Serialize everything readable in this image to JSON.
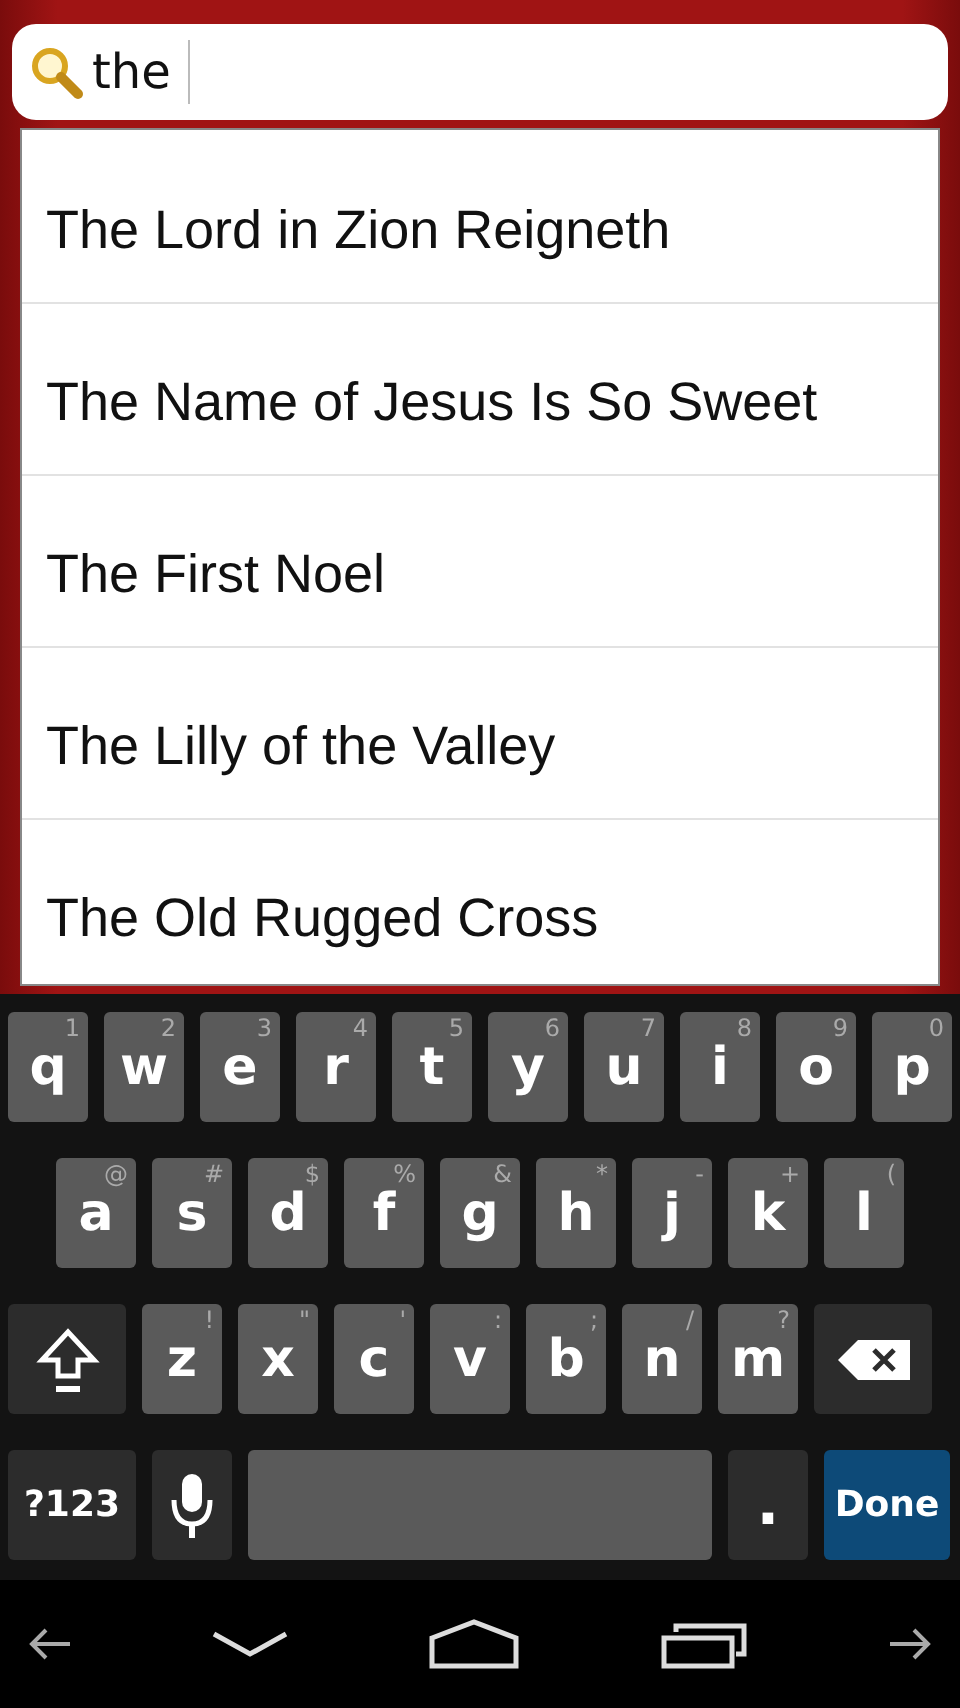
{
  "search": {
    "value": "the"
  },
  "suggestions": [
    "The Lord in Zion Reigneth",
    "The Name of Jesus Is So Sweet",
    "The First Noel",
    "The Lilly of the Valley",
    "The Old Rugged Cross"
  ],
  "keyboard": {
    "letter_rows": [
      [
        {
          "kind": "letter",
          "label": "q",
          "hint": "1"
        },
        {
          "kind": "letter",
          "label": "w",
          "hint": "2"
        },
        {
          "kind": "letter",
          "label": "e",
          "hint": "3"
        },
        {
          "kind": "letter",
          "label": "r",
          "hint": "4"
        },
        {
          "kind": "letter",
          "label": "t",
          "hint": "5"
        },
        {
          "kind": "letter",
          "label": "y",
          "hint": "6"
        },
        {
          "kind": "letter",
          "label": "u",
          "hint": "7"
        },
        {
          "kind": "letter",
          "label": "i",
          "hint": "8"
        },
        {
          "kind": "letter",
          "label": "o",
          "hint": "9"
        },
        {
          "kind": "letter",
          "label": "p",
          "hint": "0"
        }
      ],
      [
        {
          "kind": "letter",
          "label": "a",
          "hint": "@"
        },
        {
          "kind": "letter",
          "label": "s",
          "hint": "#"
        },
        {
          "kind": "letter",
          "label": "d",
          "hint": "$"
        },
        {
          "kind": "letter",
          "label": "f",
          "hint": "%"
        },
        {
          "kind": "letter",
          "label": "g",
          "hint": "&"
        },
        {
          "kind": "letter",
          "label": "h",
          "hint": "*"
        },
        {
          "kind": "letter",
          "label": "j",
          "hint": "-"
        },
        {
          "kind": "letter",
          "label": "k",
          "hint": "+"
        },
        {
          "kind": "letter",
          "label": "l",
          "hint": "("
        }
      ],
      [
        {
          "kind": "shift"
        },
        {
          "kind": "letter",
          "label": "z",
          "hint": "!"
        },
        {
          "kind": "letter",
          "label": "x",
          "hint": "\""
        },
        {
          "kind": "letter",
          "label": "c",
          "hint": "'"
        },
        {
          "kind": "letter",
          "label": "v",
          "hint": ":"
        },
        {
          "kind": "letter",
          "label": "b",
          "hint": ";"
        },
        {
          "kind": "letter",
          "label": "n",
          "hint": "/"
        },
        {
          "kind": "letter",
          "label": "m",
          "hint": "?"
        },
        {
          "kind": "backspace"
        }
      ]
    ],
    "bottom_row": {
      "keys": [
        {
          "kind": "symbols",
          "label": "?123"
        },
        {
          "kind": "mic"
        },
        {
          "kind": "space"
        },
        {
          "kind": "period",
          "label": "."
        },
        {
          "kind": "action",
          "label": "Done"
        }
      ]
    }
  }
}
